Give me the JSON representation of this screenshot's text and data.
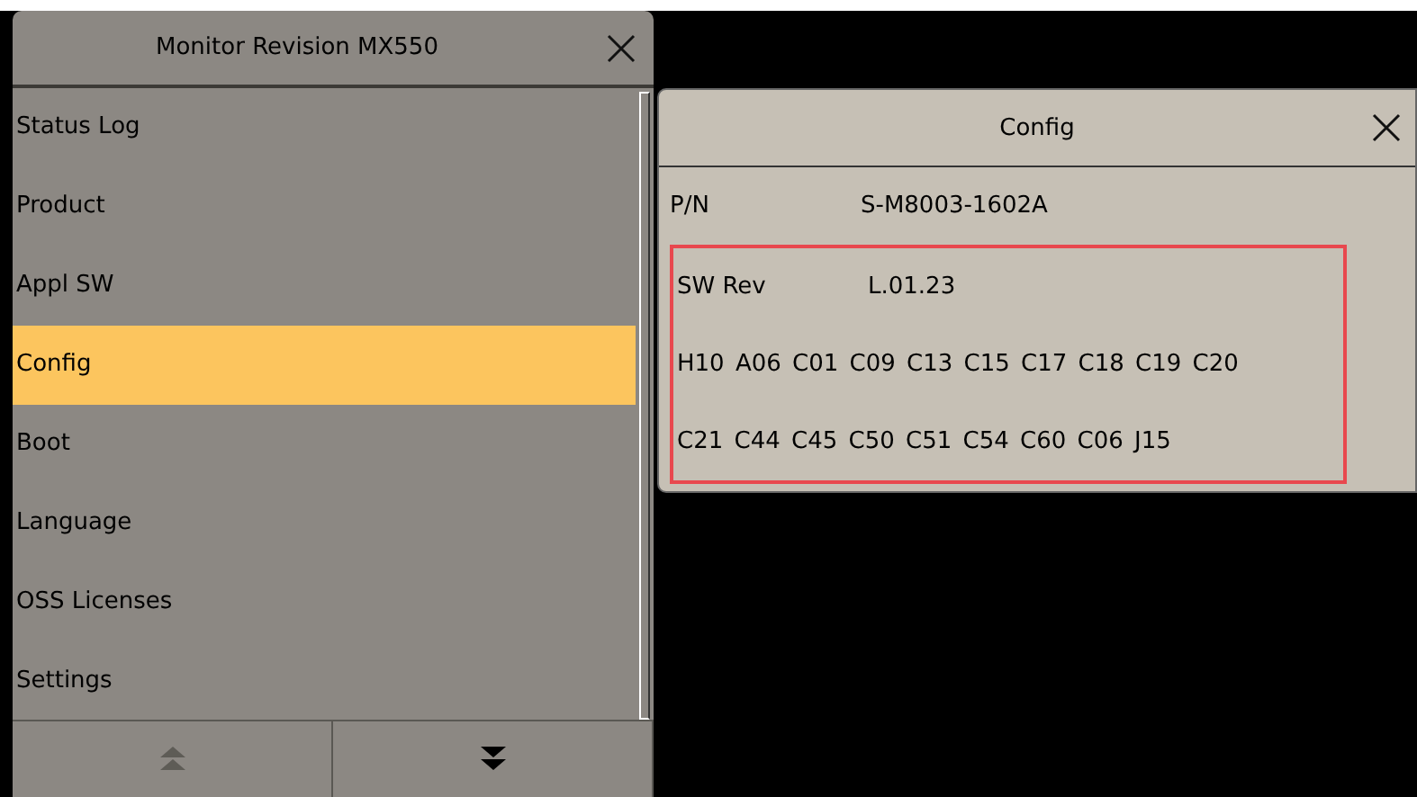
{
  "menu_window": {
    "title": "Monitor Revision MX550",
    "items": [
      {
        "label": "Status Log",
        "selected": false
      },
      {
        "label": "Product",
        "selected": false
      },
      {
        "label": "Appl SW",
        "selected": false
      },
      {
        "label": "Config",
        "selected": true
      },
      {
        "label": "Boot",
        "selected": false
      },
      {
        "label": "Language",
        "selected": false
      },
      {
        "label": "OSS Licenses",
        "selected": false
      },
      {
        "label": "Settings",
        "selected": false
      }
    ],
    "page_up": {
      "disabled": true
    },
    "page_down": {
      "disabled": false
    }
  },
  "config_window": {
    "title": "Config",
    "rows": [
      {
        "label": "P/N",
        "value": "S-M8003-1602A",
        "highlighted": false
      },
      {
        "label": "SW Rev",
        "value": "L.01.23",
        "highlighted": true
      },
      {
        "value": "H10 A06 C01 C09 C13 C15 C17 C18 C19 C20",
        "highlighted": true
      },
      {
        "value": "C21 C44 C45 C50 C51 C54 C60 C06 J15",
        "highlighted": true
      }
    ]
  }
}
